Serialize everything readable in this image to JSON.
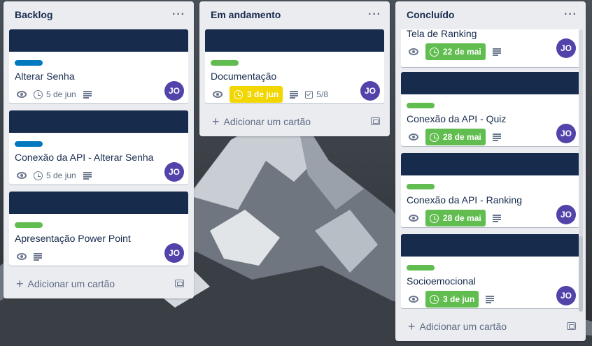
{
  "colors": {
    "cover": "#172b4d",
    "label_blue": "#0079bf",
    "label_green": "#61bd4f",
    "due_green": "#61bd4f",
    "due_yellow": "#f2d600",
    "avatar": "#5243aa"
  },
  "lists": [
    {
      "title": "Backlog",
      "menu": "···",
      "add_card": "Adicionar um cartão",
      "cards": [
        {
          "label": "blue",
          "title": "Alterar Senha",
          "due": "5 de jun",
          "avatar": "JO"
        },
        {
          "label": "blue",
          "title": "Conexão da API - Alterar Senha",
          "due": "5 de jun",
          "avatar": "JO"
        },
        {
          "label": "green",
          "title": "Apresentação Power Point",
          "avatar": "JO"
        }
      ]
    },
    {
      "title": "Em andamento",
      "menu": "···",
      "add_card": "Adicionar um cartão",
      "cards": [
        {
          "label": "green",
          "title": "Documentação",
          "due": "3 de jun",
          "due_style": "yellow",
          "checklist": "5/8",
          "avatar": "JO"
        }
      ]
    },
    {
      "title": "Concluído",
      "menu": "···",
      "add_card": "Adicionar um cartão",
      "cards": [
        {
          "title": "Tela de Ranking",
          "due": "22 de mai",
          "due_style": "green",
          "avatar": "JO"
        },
        {
          "label": "green",
          "title": "Conexão da API - Quiz",
          "due": "28 de mai",
          "due_style": "green",
          "avatar": "JO"
        },
        {
          "label": "green",
          "title": "Conexão da API - Ranking",
          "due": "28 de mai",
          "due_style": "green",
          "avatar": "JO"
        },
        {
          "label": "green",
          "title": "Socioemocional",
          "due": "3 de jun",
          "due_style": "green",
          "avatar": "JO"
        }
      ]
    }
  ],
  "icons": [
    "eye-icon",
    "clock-icon",
    "description-icon",
    "checklist-icon",
    "plus-icon",
    "template-icon",
    "more-icon"
  ]
}
